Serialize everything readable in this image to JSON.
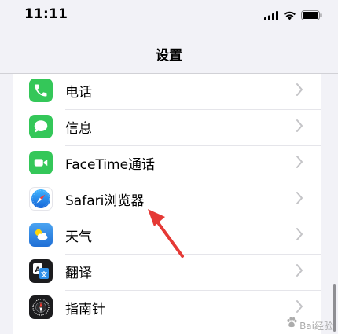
{
  "status_bar": {
    "time": "11:11",
    "icons": [
      "cellular-signal-icon",
      "wifi-icon",
      "battery-icon"
    ]
  },
  "nav": {
    "title": "设置"
  },
  "settings_list": [
    {
      "label": "电话",
      "icon": "phone-icon",
      "color": "#34c759"
    },
    {
      "label": "信息",
      "icon": "messages-icon",
      "color": "#34c759"
    },
    {
      "label": "FaceTime通话",
      "icon": "facetime-icon",
      "color": "#34c759"
    },
    {
      "label": "Safari浏览器",
      "icon": "safari-icon",
      "color": "#1e88e5"
    },
    {
      "label": "天气",
      "icon": "weather-icon",
      "color": "#2f8fe8"
    },
    {
      "label": "翻译",
      "icon": "translate-icon",
      "color": "#1c1c1e"
    },
    {
      "label": "指南针",
      "icon": "compass-icon",
      "color": "#1c1c1e"
    }
  ],
  "annotation": {
    "color": "#e53935"
  },
  "watermark": {
    "text": "Bai经验"
  }
}
